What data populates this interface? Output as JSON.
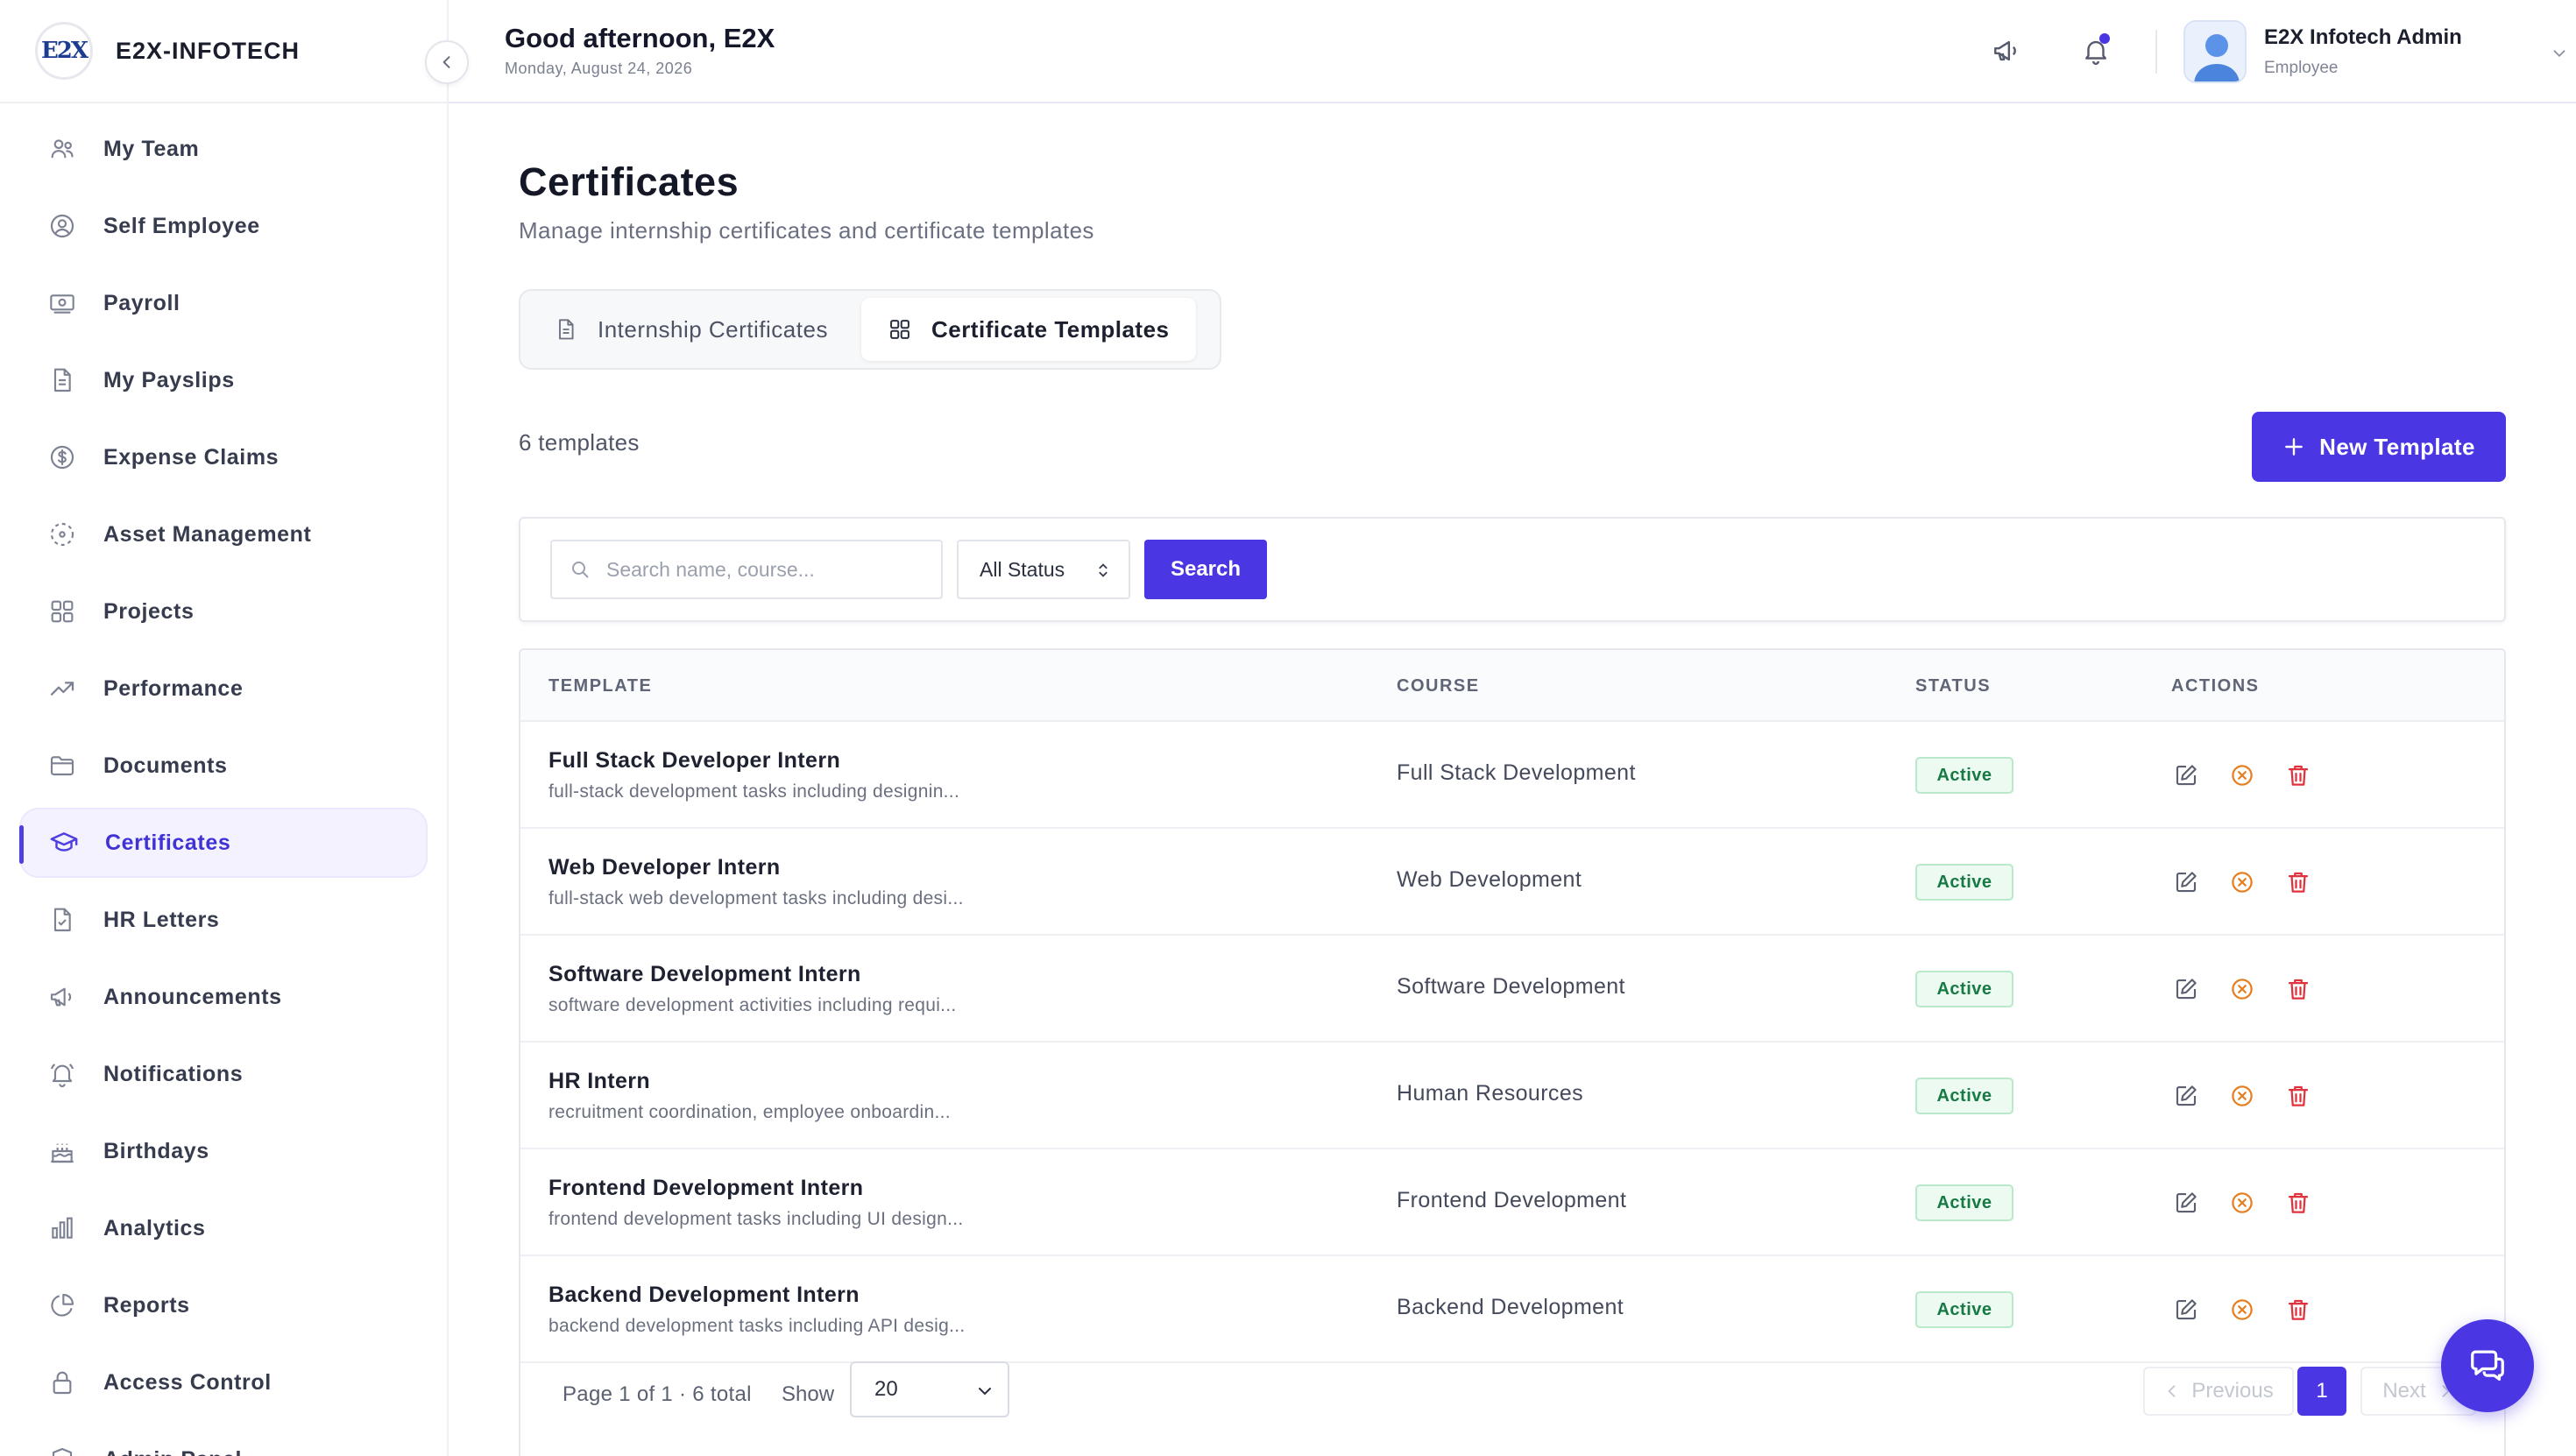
{
  "brand": {
    "name": "E2X-INFOTECH",
    "logo_text": "E2X"
  },
  "sidebar": {
    "items": [
      {
        "label": "My Team",
        "icon": "team-icon"
      },
      {
        "label": "Self Employee",
        "icon": "user-circle-icon"
      },
      {
        "label": "Payroll",
        "icon": "banknote-icon"
      },
      {
        "label": "My Payslips",
        "icon": "document-icon"
      },
      {
        "label": "Expense Claims",
        "icon": "dollar-circle-icon"
      },
      {
        "label": "Asset Management",
        "icon": "asset-icon"
      },
      {
        "label": "Projects",
        "icon": "grid-icon"
      },
      {
        "label": "Performance",
        "icon": "trending-up-icon"
      },
      {
        "label": "Documents",
        "icon": "folder-icon"
      },
      {
        "label": "Certificates",
        "icon": "graduation-cap-icon",
        "active": true
      },
      {
        "label": "HR Letters",
        "icon": "file-check-icon"
      },
      {
        "label": "Announcements",
        "icon": "megaphone-icon"
      },
      {
        "label": "Notifications",
        "icon": "bell-icon"
      },
      {
        "label": "Birthdays",
        "icon": "cake-icon"
      },
      {
        "label": "Analytics",
        "icon": "bar-chart-icon"
      },
      {
        "label": "Reports",
        "icon": "pie-chart-icon"
      },
      {
        "label": "Access Control",
        "icon": "lock-icon"
      },
      {
        "label": "Admin Panel",
        "icon": "shield-icon"
      }
    ]
  },
  "header": {
    "greeting": "Good afternoon, E2X",
    "date": "Monday, August 24, 2026",
    "user_name": "E2X Infotech Admin",
    "user_role": "Employee"
  },
  "page": {
    "title": "Certificates",
    "subtitle": "Manage internship certificates and certificate templates",
    "tabs": [
      {
        "label": "Internship Certificates",
        "active": false
      },
      {
        "label": "Certificate Templates",
        "active": true
      }
    ],
    "count_text": "6 templates",
    "new_button": "New Template"
  },
  "filters": {
    "search_placeholder": "Search name, course...",
    "status_value": "All Status",
    "search_button": "Search"
  },
  "table": {
    "columns": [
      "TEMPLATE",
      "COURSE",
      "STATUS",
      "ACTIONS"
    ],
    "rows": [
      {
        "name": "Full Stack Developer Intern",
        "desc": "full-stack development tasks including designin...",
        "course": "Full Stack Development",
        "status": "Active"
      },
      {
        "name": "Web Developer Intern",
        "desc": "full-stack web development tasks including desi...",
        "course": "Web Development",
        "status": "Active"
      },
      {
        "name": "Software Development Intern",
        "desc": "software development activities including requi...",
        "course": "Software Development",
        "status": "Active"
      },
      {
        "name": "HR Intern",
        "desc": "recruitment coordination, employee onboardin...",
        "course": "Human Resources",
        "status": "Active"
      },
      {
        "name": "Frontend Development Intern",
        "desc": "frontend development tasks including UI design...",
        "course": "Frontend Development",
        "status": "Active"
      },
      {
        "name": "Backend Development Intern",
        "desc": "backend development tasks including API desig...",
        "course": "Backend Development",
        "status": "Active"
      }
    ]
  },
  "pagination": {
    "info": "Page 1 of 1 · 6 total",
    "show_label": "Show",
    "page_size": "20",
    "prev": "Previous",
    "current": "1",
    "next": "Next"
  },
  "colors": {
    "accent": "#4b36e3",
    "active_badge_bg": "#ecfaf1",
    "active_badge_text": "#177a44",
    "edit_icon": "#5b6070",
    "deactivate_icon": "#e67e22",
    "delete_icon": "#e0323c"
  }
}
